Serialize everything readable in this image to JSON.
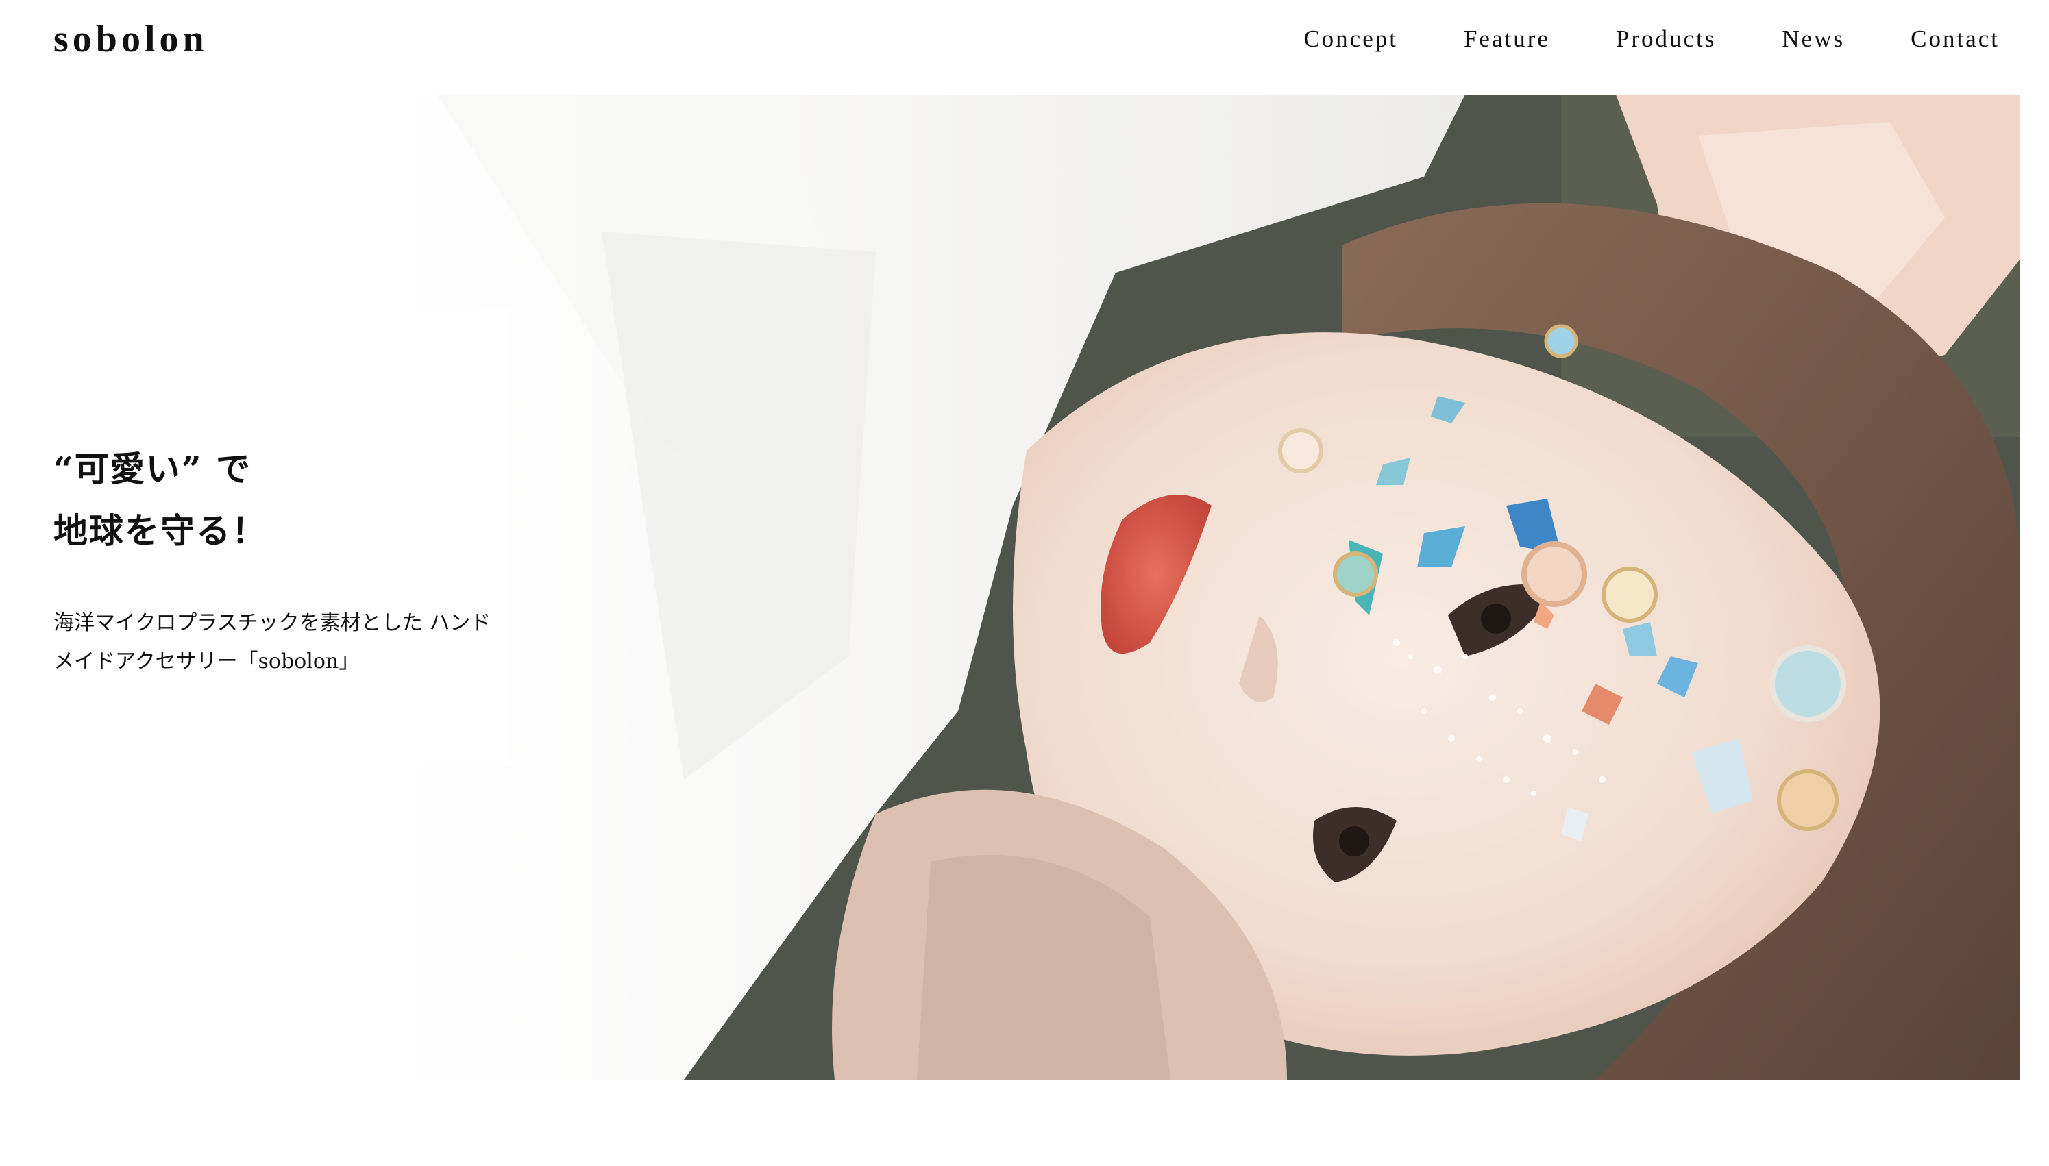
{
  "header": {
    "logo": "sobolon",
    "nav": [
      {
        "label": "Concept"
      },
      {
        "label": "Feature"
      },
      {
        "label": "Products"
      },
      {
        "label": "News"
      },
      {
        "label": "Contact"
      }
    ]
  },
  "hero": {
    "headline_line1": "“可愛い” で",
    "headline_line2": "地球を守る！",
    "description": "海洋マイクロプラスチックを素材とした ハンドメイドアクセサリー「sobolon」",
    "image": {
      "subject": "woman lying down with colourful sea-plastic fragments and accessories on her face",
      "palette": {
        "shirt": "#f4f4f2",
        "skin": "#f3dfd3",
        "hair": "#6e5446",
        "background_dark": "#4e534a",
        "lips": "#d7584a",
        "accent_blue": "#3f86c6",
        "accent_teal": "#4bb4b6"
      }
    }
  }
}
